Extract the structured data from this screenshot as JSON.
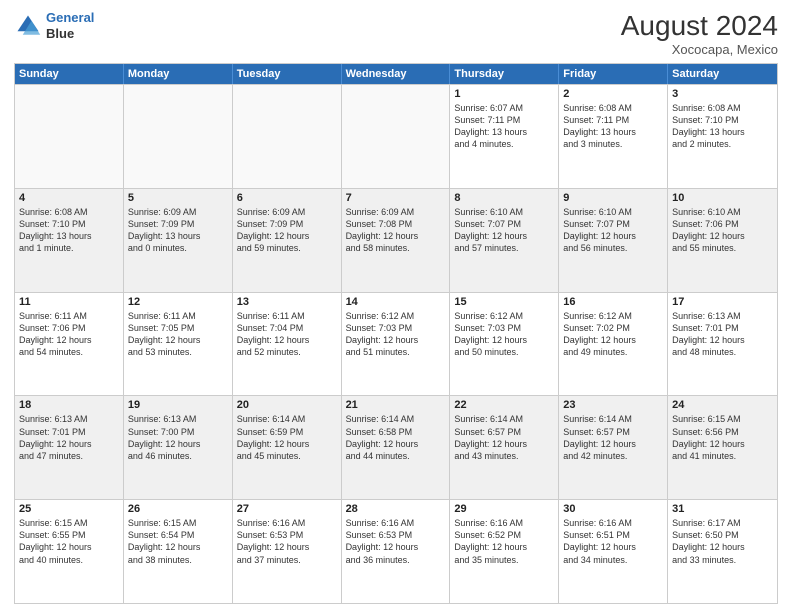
{
  "header": {
    "logo_line1": "General",
    "logo_line2": "Blue",
    "month_year": "August 2024",
    "location": "Xococapa, Mexico"
  },
  "weekdays": [
    "Sunday",
    "Monday",
    "Tuesday",
    "Wednesday",
    "Thursday",
    "Friday",
    "Saturday"
  ],
  "weeks": [
    [
      {
        "day": "",
        "info": "",
        "empty": true
      },
      {
        "day": "",
        "info": "",
        "empty": true
      },
      {
        "day": "",
        "info": "",
        "empty": true
      },
      {
        "day": "",
        "info": "",
        "empty": true
      },
      {
        "day": "1",
        "info": "Sunrise: 6:07 AM\nSunset: 7:11 PM\nDaylight: 13 hours\nand 4 minutes.",
        "empty": false
      },
      {
        "day": "2",
        "info": "Sunrise: 6:08 AM\nSunset: 7:11 PM\nDaylight: 13 hours\nand 3 minutes.",
        "empty": false
      },
      {
        "day": "3",
        "info": "Sunrise: 6:08 AM\nSunset: 7:10 PM\nDaylight: 13 hours\nand 2 minutes.",
        "empty": false
      }
    ],
    [
      {
        "day": "4",
        "info": "Sunrise: 6:08 AM\nSunset: 7:10 PM\nDaylight: 13 hours\nand 1 minute.",
        "empty": false
      },
      {
        "day": "5",
        "info": "Sunrise: 6:09 AM\nSunset: 7:09 PM\nDaylight: 13 hours\nand 0 minutes.",
        "empty": false
      },
      {
        "day": "6",
        "info": "Sunrise: 6:09 AM\nSunset: 7:09 PM\nDaylight: 12 hours\nand 59 minutes.",
        "empty": false
      },
      {
        "day": "7",
        "info": "Sunrise: 6:09 AM\nSunset: 7:08 PM\nDaylight: 12 hours\nand 58 minutes.",
        "empty": false
      },
      {
        "day": "8",
        "info": "Sunrise: 6:10 AM\nSunset: 7:07 PM\nDaylight: 12 hours\nand 57 minutes.",
        "empty": false
      },
      {
        "day": "9",
        "info": "Sunrise: 6:10 AM\nSunset: 7:07 PM\nDaylight: 12 hours\nand 56 minutes.",
        "empty": false
      },
      {
        "day": "10",
        "info": "Sunrise: 6:10 AM\nSunset: 7:06 PM\nDaylight: 12 hours\nand 55 minutes.",
        "empty": false
      }
    ],
    [
      {
        "day": "11",
        "info": "Sunrise: 6:11 AM\nSunset: 7:06 PM\nDaylight: 12 hours\nand 54 minutes.",
        "empty": false
      },
      {
        "day": "12",
        "info": "Sunrise: 6:11 AM\nSunset: 7:05 PM\nDaylight: 12 hours\nand 53 minutes.",
        "empty": false
      },
      {
        "day": "13",
        "info": "Sunrise: 6:11 AM\nSunset: 7:04 PM\nDaylight: 12 hours\nand 52 minutes.",
        "empty": false
      },
      {
        "day": "14",
        "info": "Sunrise: 6:12 AM\nSunset: 7:03 PM\nDaylight: 12 hours\nand 51 minutes.",
        "empty": false
      },
      {
        "day": "15",
        "info": "Sunrise: 6:12 AM\nSunset: 7:03 PM\nDaylight: 12 hours\nand 50 minutes.",
        "empty": false
      },
      {
        "day": "16",
        "info": "Sunrise: 6:12 AM\nSunset: 7:02 PM\nDaylight: 12 hours\nand 49 minutes.",
        "empty": false
      },
      {
        "day": "17",
        "info": "Sunrise: 6:13 AM\nSunset: 7:01 PM\nDaylight: 12 hours\nand 48 minutes.",
        "empty": false
      }
    ],
    [
      {
        "day": "18",
        "info": "Sunrise: 6:13 AM\nSunset: 7:01 PM\nDaylight: 12 hours\nand 47 minutes.",
        "empty": false
      },
      {
        "day": "19",
        "info": "Sunrise: 6:13 AM\nSunset: 7:00 PM\nDaylight: 12 hours\nand 46 minutes.",
        "empty": false
      },
      {
        "day": "20",
        "info": "Sunrise: 6:14 AM\nSunset: 6:59 PM\nDaylight: 12 hours\nand 45 minutes.",
        "empty": false
      },
      {
        "day": "21",
        "info": "Sunrise: 6:14 AM\nSunset: 6:58 PM\nDaylight: 12 hours\nand 44 minutes.",
        "empty": false
      },
      {
        "day": "22",
        "info": "Sunrise: 6:14 AM\nSunset: 6:57 PM\nDaylight: 12 hours\nand 43 minutes.",
        "empty": false
      },
      {
        "day": "23",
        "info": "Sunrise: 6:14 AM\nSunset: 6:57 PM\nDaylight: 12 hours\nand 42 minutes.",
        "empty": false
      },
      {
        "day": "24",
        "info": "Sunrise: 6:15 AM\nSunset: 6:56 PM\nDaylight: 12 hours\nand 41 minutes.",
        "empty": false
      }
    ],
    [
      {
        "day": "25",
        "info": "Sunrise: 6:15 AM\nSunset: 6:55 PM\nDaylight: 12 hours\nand 40 minutes.",
        "empty": false
      },
      {
        "day": "26",
        "info": "Sunrise: 6:15 AM\nSunset: 6:54 PM\nDaylight: 12 hours\nand 38 minutes.",
        "empty": false
      },
      {
        "day": "27",
        "info": "Sunrise: 6:16 AM\nSunset: 6:53 PM\nDaylight: 12 hours\nand 37 minutes.",
        "empty": false
      },
      {
        "day": "28",
        "info": "Sunrise: 6:16 AM\nSunset: 6:53 PM\nDaylight: 12 hours\nand 36 minutes.",
        "empty": false
      },
      {
        "day": "29",
        "info": "Sunrise: 6:16 AM\nSunset: 6:52 PM\nDaylight: 12 hours\nand 35 minutes.",
        "empty": false
      },
      {
        "day": "30",
        "info": "Sunrise: 6:16 AM\nSunset: 6:51 PM\nDaylight: 12 hours\nand 34 minutes.",
        "empty": false
      },
      {
        "day": "31",
        "info": "Sunrise: 6:17 AM\nSunset: 6:50 PM\nDaylight: 12 hours\nand 33 minutes.",
        "empty": false
      }
    ]
  ]
}
